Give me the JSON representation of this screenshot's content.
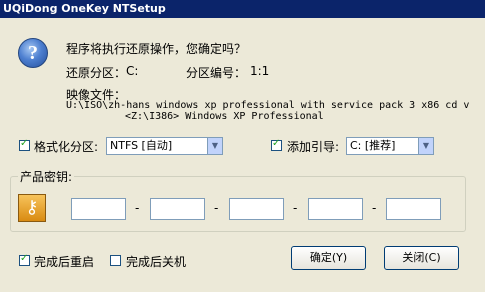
{
  "window": {
    "title": "UQiDong OneKey NTSetup"
  },
  "message": {
    "question": "程序将执行还原操作，您确定吗？",
    "partition_label": "还原分区：",
    "partition_value": "C:",
    "partition_number_label": "分区编号：",
    "partition_number_value": "1:1",
    "image_file_label": "映像文件：",
    "image_path_line1": "U:\\ISO\\zh-hans windows xp professional with service pack 3 x86 cd v",
    "image_path_line2": "<Z:\\I386> Windows XP Professional"
  },
  "format": {
    "label": "格式化分区:",
    "value": "NTFS [自动]",
    "checked": true
  },
  "boot": {
    "label": "添加引导:",
    "value": "C: [推荐]",
    "checked": true
  },
  "product_key": {
    "label": "产品密钥:",
    "fields": [
      "",
      "",
      "",
      "",
      ""
    ],
    "separator": "-"
  },
  "options": {
    "reboot_label": "完成后重启",
    "reboot_checked": true,
    "shutdown_label": "完成后关机",
    "shutdown_checked": false
  },
  "buttons": {
    "ok": "确定(Y)",
    "close": "关闭(C)"
  }
}
